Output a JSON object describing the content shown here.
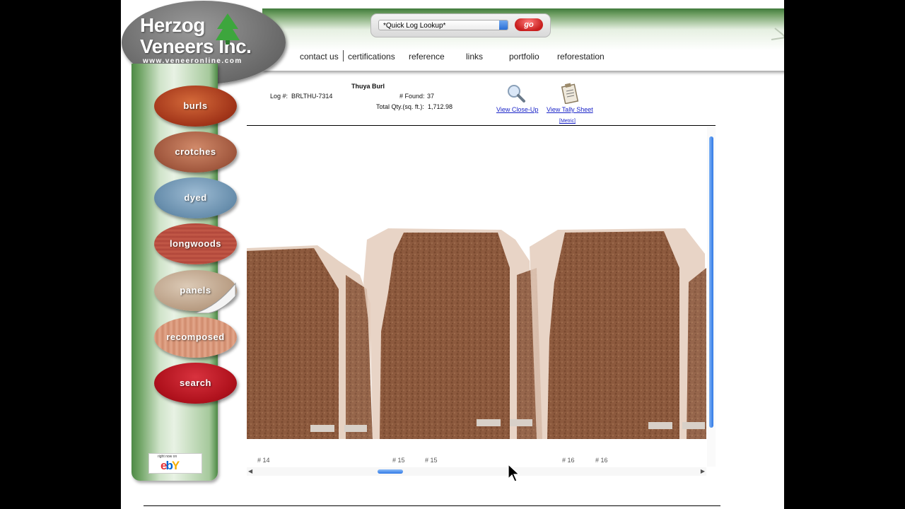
{
  "brand": {
    "line1": "Herzog",
    "line2": "Veneers Inc.",
    "url": "www.veneeronline.com"
  },
  "lookup": {
    "selected": "*Quick Log Lookup*",
    "go_label": "go"
  },
  "nav": [
    {
      "label": "contact us"
    },
    {
      "label": "certifications"
    },
    {
      "label": "reference"
    },
    {
      "label": "links"
    },
    {
      "label": "portfolio"
    },
    {
      "label": "reforestation"
    }
  ],
  "sidebar": {
    "items": [
      {
        "label": "burls",
        "color": "#b3431e"
      },
      {
        "label": "crotches",
        "color": "#b46a4f"
      },
      {
        "label": "dyed",
        "color": "#6f95b3"
      },
      {
        "label": "longwoods",
        "color": "#b44c3c"
      },
      {
        "label": "panels",
        "color": "#bfa690"
      },
      {
        "label": "recomposed",
        "color": "#d6957a"
      },
      {
        "label": "search",
        "color": "#b3121d"
      }
    ],
    "ebay_tagline": "right now on",
    "ebay_logo": "ebY"
  },
  "log": {
    "species": "Thuya Burl",
    "log_label": "Log #:",
    "log_number": "BRLTHU-7314",
    "found_label": "# Found:",
    "found_value": "37",
    "qty_label": "Total Qty.(sq. ft.):",
    "qty_value": "1,712.98"
  },
  "actions": {
    "close_up": "View Close-Up",
    "tally": "View Tally Sheet",
    "metric": "[Metric]"
  },
  "sheets": [
    {
      "label": "# 14"
    },
    {
      "label": "# 15"
    },
    {
      "label": "# 15"
    },
    {
      "label": "# 16"
    },
    {
      "label": "# 16"
    }
  ]
}
